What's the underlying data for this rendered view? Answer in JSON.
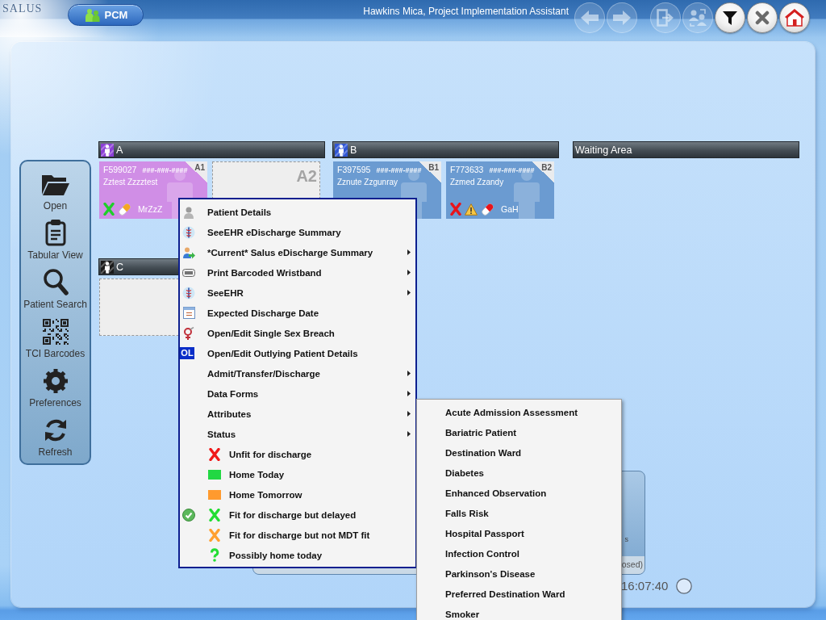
{
  "header": {
    "logo": "SALUS",
    "module_button": "PCM",
    "user": "Hawkins Mica, Project Implementation Assistant",
    "toolbar": [
      {
        "disabled": true
      },
      {
        "disabled": true
      },
      {
        "disabled": true
      },
      {
        "disabled": true
      },
      {
        "disabled": false
      },
      {
        "disabled": false
      },
      {
        "disabled": false
      }
    ]
  },
  "sidebar": {
    "items": [
      {
        "label": "Open"
      },
      {
        "label": "Tabular View"
      },
      {
        "label": "Patient Search"
      },
      {
        "label": "TCI Barcodes"
      },
      {
        "label": "Preferences"
      },
      {
        "label": "Refresh"
      }
    ]
  },
  "bays": [
    {
      "label": "A",
      "color": "#8b3fd6",
      "cards": [
        {
          "bed": "A1",
          "occupied": true,
          "color": "#d08ee6",
          "number": "F599027",
          "nhs_number": "###-###-####",
          "name": "Zztest Zzzztest",
          "initials": "MrZzZ",
          "flags": [
            {
              "kind": "cross",
              "color": "#1fcf2a"
            },
            {
              "kind": "pill",
              "color": "#f5a623"
            }
          ]
        },
        {
          "bed": "A2",
          "occupied": false
        }
      ]
    },
    {
      "label": "B",
      "color": "#2f55d4",
      "cards": [
        {
          "bed": "B1",
          "occupied": true,
          "color": "#6b9bd1",
          "number": "F397595",
          "nhs_number": "###-###-####",
          "name": "Zznute Zzgunray"
        },
        {
          "bed": "B2",
          "occupied": true,
          "color": "#6b9bd1",
          "number": "F773633",
          "nhs_number": "###-###-####",
          "name": "Zzmed Zzandy",
          "initials": "GaH",
          "flags": [
            {
              "kind": "cross",
              "color": "#e8141b"
            },
            {
              "kind": "warning"
            },
            {
              "kind": "pill",
              "color": "#e8141b"
            }
          ]
        }
      ]
    },
    {
      "label": "Waiting Area"
    },
    {
      "label": "C",
      "color": "#1a1a1a",
      "cards": [
        {
          "occupied": false
        }
      ]
    }
  ],
  "info_panel": {
    "text": "s",
    "footer": "osed)"
  },
  "clock": "16:07:40",
  "context_menu": {
    "items": [
      {
        "label": "Patient Details",
        "submenu": false
      },
      {
        "label": "SeeEHR eDischarge Summary",
        "submenu": false
      },
      {
        "label": "*Current* Salus eDischarge Summary",
        "submenu": true
      },
      {
        "label": "Print Barcoded Wristband",
        "submenu": true
      },
      {
        "label": "SeeEHR",
        "submenu": true
      },
      {
        "label": "Expected Discharge Date",
        "submenu": false
      },
      {
        "label": "Open/Edit Single Sex Breach",
        "submenu": false
      },
      {
        "label": "Open/Edit Outlying Patient Details",
        "submenu": false,
        "badge": "OL"
      },
      {
        "label": "Admit/Transfer/Discharge",
        "submenu": true
      },
      {
        "label": "Data Forms",
        "submenu": true
      },
      {
        "label": "Attributes",
        "submenu": true
      },
      {
        "label": "Status",
        "submenu": true
      }
    ],
    "status_options": [
      {
        "label": "Unfit for discharge",
        "kind": "cross",
        "color": "#f01818",
        "checked": false
      },
      {
        "label": "Home Today",
        "kind": "square",
        "color": "#22d843",
        "checked": false
      },
      {
        "label": "Home Tomorrow",
        "kind": "square",
        "color": "#ff9a2e",
        "checked": false
      },
      {
        "label": "Fit for discharge but delayed",
        "kind": "cross",
        "color": "#22dd33",
        "checked": true
      },
      {
        "label": "Fit for discharge but not MDT fit",
        "kind": "cross",
        "color": "#ffa030",
        "checked": false
      },
      {
        "label": "Possibly home today",
        "kind": "question",
        "color": "#22dd33",
        "checked": false
      }
    ]
  },
  "attributes_submenu": {
    "items": [
      "Acute Admission Assessment",
      "Bariatric Patient",
      "Destination Ward",
      "Diabetes",
      "Enhanced Observation",
      "Falls Risk",
      "Hospital Passport",
      "Infection Control",
      "Parkinson's Disease",
      "Preferred Destination Ward",
      "Smoker"
    ]
  }
}
